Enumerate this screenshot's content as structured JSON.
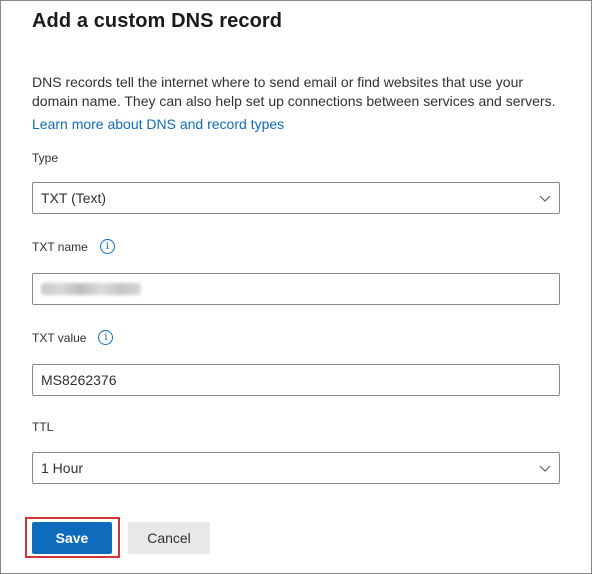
{
  "panel": {
    "title": "Add a custom DNS record",
    "description": "DNS records tell the internet where to send email or find websites that use your domain name. They can also help set up connections between services and servers.",
    "learn_more_link": "Learn more about DNS and record types"
  },
  "form": {
    "type": {
      "label": "Type",
      "value": "TXT (Text)"
    },
    "txt_name": {
      "label": "TXT name",
      "value_redacted": true
    },
    "txt_value": {
      "label": "TXT value",
      "value": "MS8262376"
    },
    "ttl": {
      "label": "TTL",
      "value": "1 Hour"
    }
  },
  "buttons": {
    "save_label": "Save",
    "cancel_label": "Cancel"
  },
  "icons": {
    "info": "info-icon",
    "dropdown": "chevron-down-icon"
  },
  "colors": {
    "accent": "#0f6cbd",
    "highlight_outline": "#d13438",
    "cancel_bg": "#e8e8e8"
  }
}
